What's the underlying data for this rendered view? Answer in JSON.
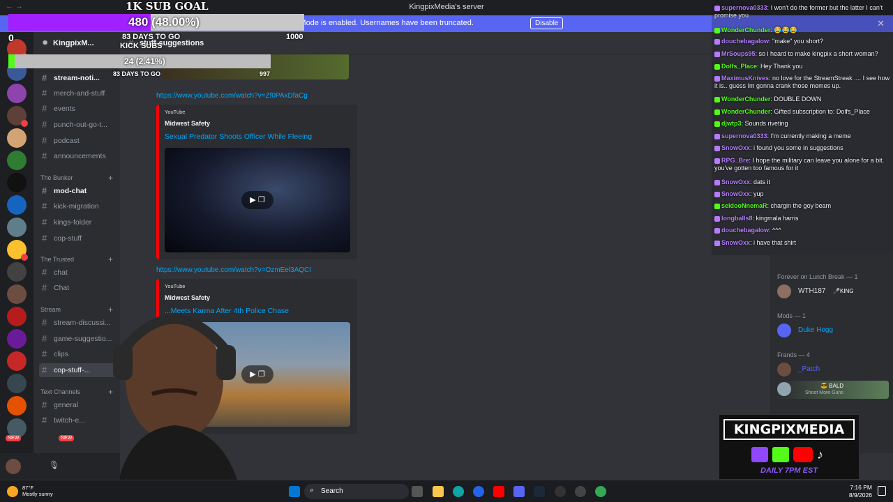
{
  "window": {
    "title": "KingpixMedia's server",
    "nav": "← →"
  },
  "streamer_mode": {
    "text": "Streamer Mode is enabled. Usernames have been truncated.",
    "button": "Disable",
    "close": "✕"
  },
  "guild": {
    "name": "KingpixM...",
    "chevron": "⌄"
  },
  "channel_header": {
    "name": "stuff-suggestions"
  },
  "channels": [
    {
      "name": "stream-noti...",
      "state": "unread"
    },
    {
      "name": "merch-and-stuff",
      "state": "normal"
    },
    {
      "name": "events",
      "state": "normal"
    },
    {
      "name": "punch-out-go-t...",
      "state": "normal"
    },
    {
      "name": "podcast",
      "state": "normal"
    },
    {
      "name": "announcements",
      "state": "normal"
    },
    {
      "name": "mod-chat",
      "state": "unread"
    },
    {
      "name": "kick-migration",
      "state": "normal"
    },
    {
      "name": "kings-folder",
      "state": "normal"
    },
    {
      "name": "cop-stuff",
      "state": "normal"
    },
    {
      "name": "chat",
      "state": "normal"
    },
    {
      "name": "Chat",
      "state": "normal"
    },
    {
      "name": "stream-discussi...",
      "state": "normal"
    },
    {
      "name": "game-suggestio...",
      "state": "normal"
    },
    {
      "name": "clips",
      "state": "normal"
    },
    {
      "name": "cop-stuff-...",
      "state": "active"
    },
    {
      "name": "general",
      "state": "normal"
    },
    {
      "name": "twitch-e...",
      "state": "normal"
    }
  ],
  "categories": [
    "The Bunker",
    "The Trusted",
    "Stream",
    "Text Channels"
  ],
  "messages": {
    "link1": "https://www.youtube.com/watch?v=Zf0PAxDfaCg",
    "embed1": {
      "provider": "YouTube",
      "author": "Midwest Safety",
      "title": "Sexual Predator Shoots Officer While Fleeing"
    },
    "link2": "https://www.youtube.com/watch?v=OzmEel3AQCI",
    "embed2": {
      "provider": "YouTube",
      "author": "Midwest Safety",
      "title": "...Meets Karma After 4th Police Chase"
    },
    "play_icon": "▶ ❐"
  },
  "goal": {
    "title": "1K SUB GOAL",
    "value": "480 (48.00%)",
    "fraction": 0.48,
    "days_left": "83 DAYS TO GO",
    "target": "1000",
    "kick_label": "KICK SUBS",
    "kick_value": "24 (2.41%)",
    "kick_fraction": 0.0241,
    "kick_days": "83 DAYS TO GO",
    "kick_target": "997",
    "counter": "0"
  },
  "chat": [
    {
      "user": "supernova0333",
      "color": "#b57bff",
      "text": "I won't do the former but the latter I can't promise you"
    },
    {
      "user": "WonderChunder",
      "color": "#53fc18",
      "text": "😂😂😂"
    },
    {
      "user": "douchebagalow",
      "color": "#b57bff",
      "text": "\"make\" you short?"
    },
    {
      "user": "MrSoups95",
      "color": "#b57bff",
      "text": "so i heard to make kingpix a short woman?"
    },
    {
      "user": "Dolfs_Place",
      "color": "#53fc18",
      "text": "Hey Thank you"
    },
    {
      "user": "MaximusKnives",
      "color": "#b57bff",
      "text": "no love for the StreamStreak .... I see how it is.. guess Im gonna crank those memes up."
    },
    {
      "user": "WonderChunder",
      "color": "#53fc18",
      "text": "DOUBLE DOWN"
    },
    {
      "user": "WonderChunder",
      "color": "#53fc18",
      "text": "Gifted subscription to: Dolfs_Place"
    },
    {
      "user": "djwtp3",
      "color": "#53fc18",
      "text": "Sounds riveting"
    },
    {
      "user": "supernova0333",
      "color": "#b57bff",
      "text": "I'm currently making a meme"
    },
    {
      "user": "SnowOxx",
      "color": "#b57bff",
      "text": "i found you some in suggestions"
    },
    {
      "user": "RPG_Bre",
      "color": "#b57bff",
      "text": "I hope the military can leave you alone for a bit. you've gotten too famous for it"
    },
    {
      "user": "SnowOxx",
      "color": "#b57bff",
      "text": "dats it"
    },
    {
      "user": "SnowOxx",
      "color": "#b57bff",
      "text": "yup"
    },
    {
      "user": "seldooNnemaR",
      "color": "#53fc18",
      "text": "chargin the goy beam"
    },
    {
      "user": "longballs8",
      "color": "#b57bff",
      "text": "kingmala harris"
    },
    {
      "user": "douchebagalow",
      "color": "#b57bff",
      "text": "^^^"
    },
    {
      "user": "SnowOxx",
      "color": "#b57bff",
      "text": "i have that shirt"
    }
  ],
  "members": {
    "cat_forever": "Forever on Lunch Break — 1",
    "wth": "WTH187",
    "wth_tag": "🎤KING",
    "cat_mods": "Mods — 1",
    "duke": "Duke Hogg",
    "cat_frands": "Frands — 4",
    "patch": "_Patch",
    "bald": "😎 BALD",
    "bald_sub": "Shoot More Guns"
  },
  "brand": {
    "title": "KINGPIXMEDIA",
    "sub": "DAILY 7PM EST"
  },
  "taskbar": {
    "search": "Search",
    "temp": "87°F",
    "weather": "Mostly sunny",
    "time": "7:16 PM",
    "date": "8/9/2026"
  },
  "badges": {
    "new1": "NEW",
    "new2": "NEW"
  },
  "colors": {
    "accent": "#5865f2",
    "twitch": "#9146ff",
    "kick": "#53fc18",
    "link": "#00a8fc"
  }
}
